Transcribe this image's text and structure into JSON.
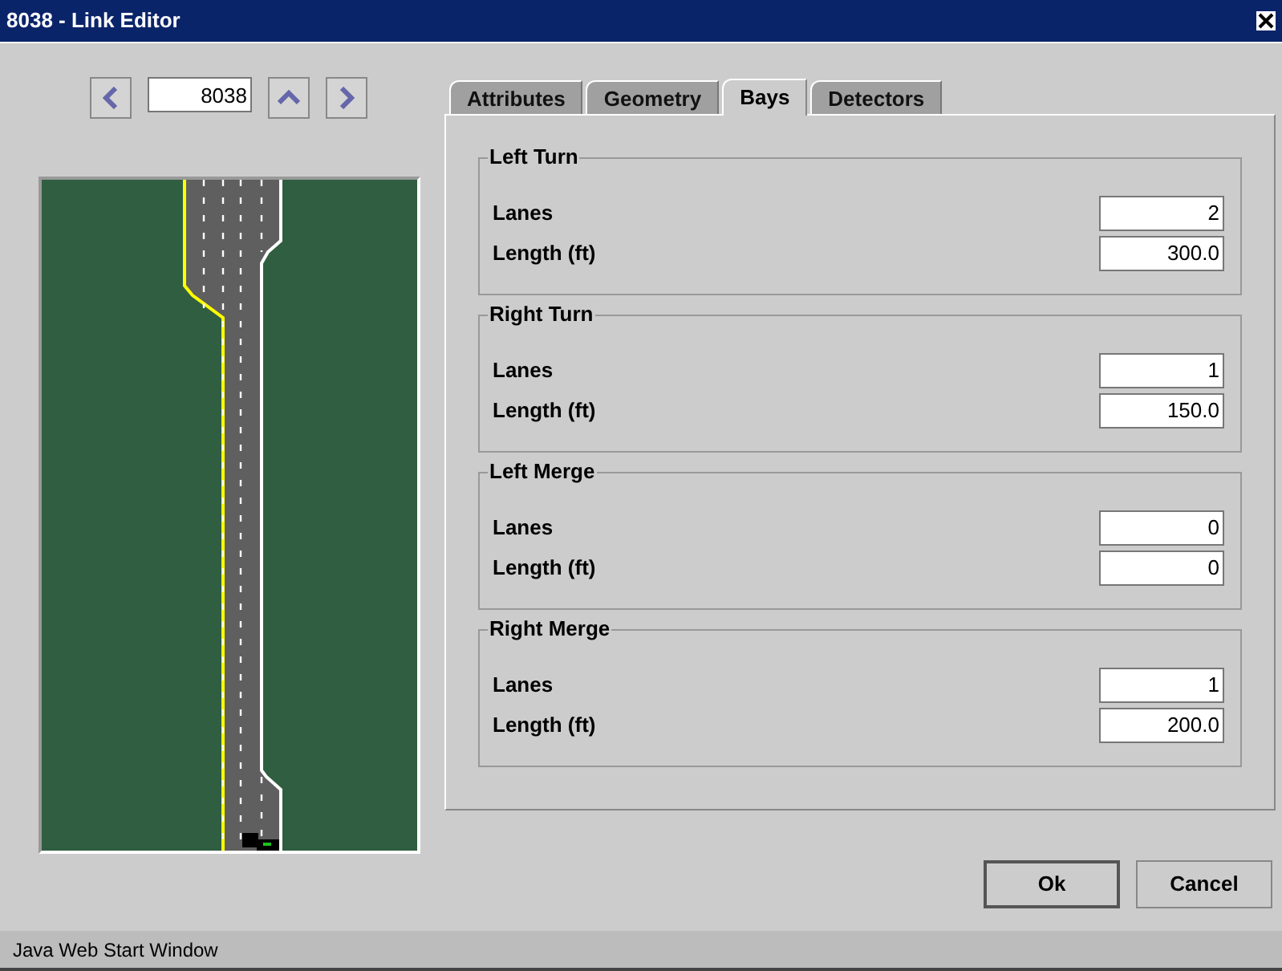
{
  "window": {
    "title": "8038 - Link Editor"
  },
  "navigator": {
    "link_id": "8038"
  },
  "tabs": [
    {
      "label": "Attributes",
      "selected": false
    },
    {
      "label": "Geometry",
      "selected": false
    },
    {
      "label": "Bays",
      "selected": true
    },
    {
      "label": "Detectors",
      "selected": false
    }
  ],
  "groups": [
    {
      "title": "Left Turn",
      "fields": [
        {
          "label": "Lanes",
          "value": "2"
        },
        {
          "label": "Length (ft)",
          "value": "300.0"
        }
      ]
    },
    {
      "title": "Right Turn",
      "fields": [
        {
          "label": "Lanes",
          "value": "1"
        },
        {
          "label": "Length (ft)",
          "value": "150.0"
        }
      ]
    },
    {
      "title": "Left Merge",
      "fields": [
        {
          "label": "Lanes",
          "value": "0"
        },
        {
          "label": "Length (ft)",
          "value": "0"
        }
      ]
    },
    {
      "title": "Right Merge",
      "fields": [
        {
          "label": "Lanes",
          "value": "1"
        },
        {
          "label": "Length (ft)",
          "value": "200.0"
        }
      ]
    }
  ],
  "buttons": [
    {
      "label": "Ok",
      "default": true
    },
    {
      "label": "Cancel",
      "default": false
    }
  ],
  "status_bar": "Java Web Start Window"
}
